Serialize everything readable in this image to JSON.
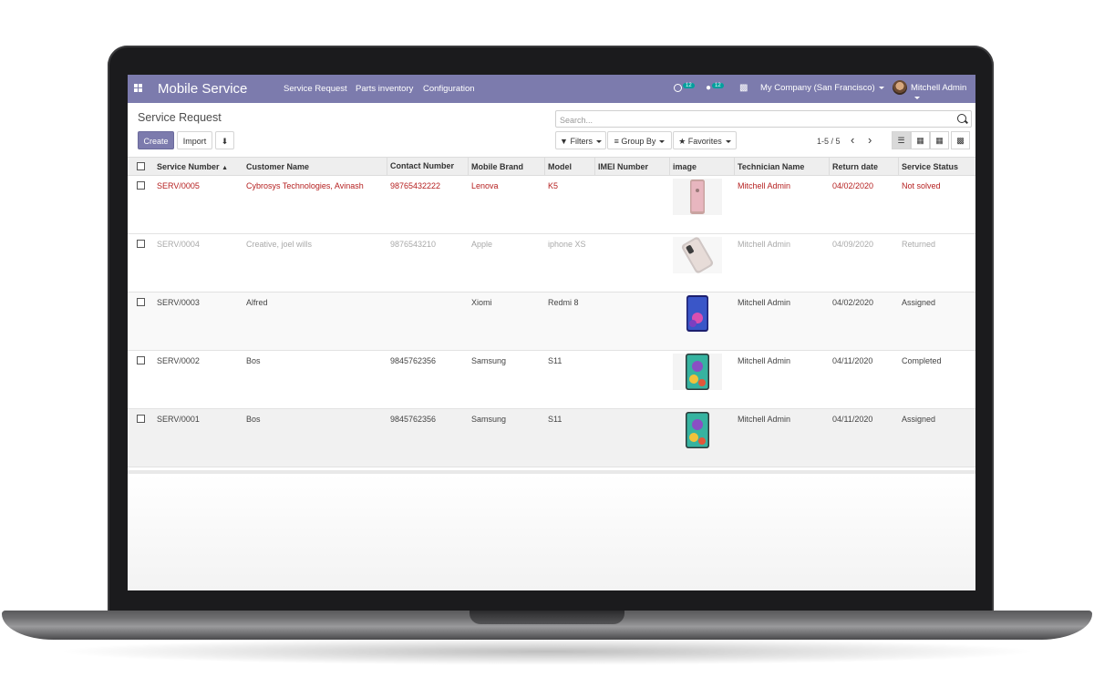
{
  "navbar": {
    "brand": "Mobile Service",
    "menu": [
      "Service Request",
      "Parts inventory",
      "Configuration"
    ],
    "activity_count": "12",
    "message_count": "12",
    "company": "My Company (San Francisco)",
    "user": "Mitchell Admin",
    "color": "#7c7bad"
  },
  "control": {
    "breadcrumb": "Service Request",
    "create_label": "Create",
    "import_label": "Import",
    "search_placeholder": "Search...",
    "filters_label": "Filters",
    "groupby_label": "Group By",
    "favorites_label": "Favorites",
    "pager": "1-5 / 5"
  },
  "table": {
    "columns": [
      "Service Number",
      "Customer Name",
      "Contact Number",
      "Mobile Brand",
      "Model",
      "IMEI Number",
      "image",
      "Technician Name",
      "Return date",
      "Service Status"
    ],
    "rows": [
      {
        "number": "SERV/0005",
        "customer": "Cybrosys Technologies, Avinash",
        "contact": "98765432222",
        "brand": "Lenova",
        "model": "K5",
        "imei": "",
        "image_icon": "phone-pink-icon",
        "technician": "Mitchell Admin",
        "return_date": "04/02/2020",
        "status": "Not solved"
      },
      {
        "number": "SERV/0004",
        "customer": "Creative, joel wills",
        "contact": "9876543210",
        "brand": "Apple",
        "model": "iphone XS",
        "imei": "",
        "image_icon": "phone-iphone-icon",
        "technician": "Mitchell Admin",
        "return_date": "04/09/2020",
        "status": "Returned"
      },
      {
        "number": "SERV/0003",
        "customer": "Alfred",
        "contact": "",
        "brand": "Xiomi",
        "model": "Redmi 8",
        "imei": "",
        "image_icon": "phone-blue-icon",
        "technician": "Mitchell Admin",
        "return_date": "04/02/2020",
        "status": "Assigned"
      },
      {
        "number": "SERV/0002",
        "customer": "Bos",
        "contact": "9845762356",
        "brand": "Samsung",
        "model": "S11",
        "imei": "",
        "image_icon": "phone-samsung-icon",
        "technician": "Mitchell Admin",
        "return_date": "04/11/2020",
        "status": "Completed"
      },
      {
        "number": "SERV/0001",
        "customer": "Bos",
        "contact": "9845762356",
        "brand": "Samsung",
        "model": "S11",
        "imei": "",
        "image_icon": "phone-samsung-icon",
        "technician": "Mitchell Admin",
        "return_date": "04/11/2020",
        "status": "Assigned"
      }
    ]
  }
}
